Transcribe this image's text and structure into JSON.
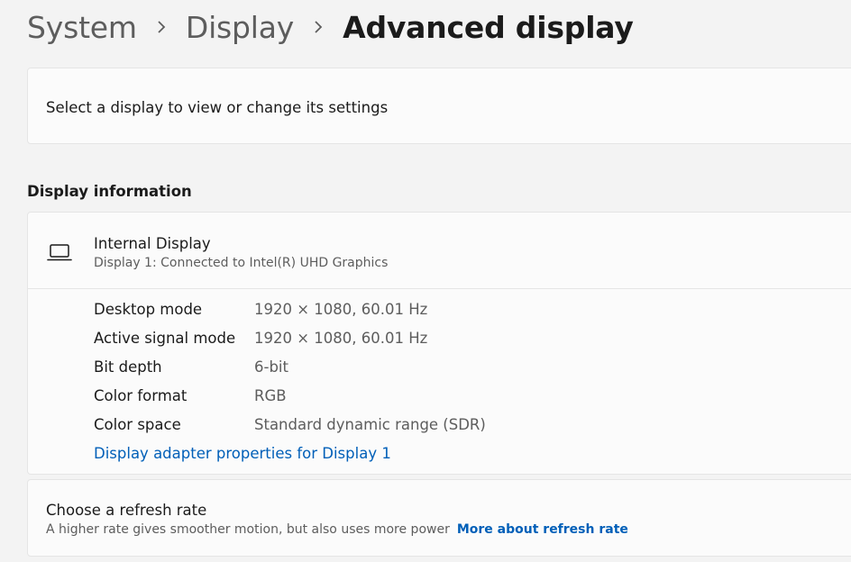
{
  "breadcrumb": {
    "items": [
      "System",
      "Display",
      "Advanced display"
    ]
  },
  "select_display": {
    "text": "Select a display to view or change its settings"
  },
  "display_information": {
    "section_title": "Display information",
    "display_name": "Internal Display",
    "display_subtitle": "Display 1: Connected to Intel(R) UHD Graphics",
    "icon": "laptop-icon",
    "properties": [
      {
        "label": "Desktop mode",
        "value": "1920 × 1080, 60.01 Hz"
      },
      {
        "label": "Active signal mode",
        "value": "1920 × 1080, 60.01 Hz"
      },
      {
        "label": "Bit depth",
        "value": "6-bit"
      },
      {
        "label": "Color format",
        "value": "RGB"
      },
      {
        "label": "Color space",
        "value": "Standard dynamic range (SDR)"
      }
    ],
    "adapter_link": "Display adapter properties for Display 1"
  },
  "refresh_rate": {
    "title": "Choose a refresh rate",
    "description": "A higher rate gives smoother motion, but also uses more power",
    "link": "More about refresh rate"
  },
  "colors": {
    "accent": "#005fb8",
    "background": "#f3f3f3",
    "card": "#fbfbfb"
  }
}
